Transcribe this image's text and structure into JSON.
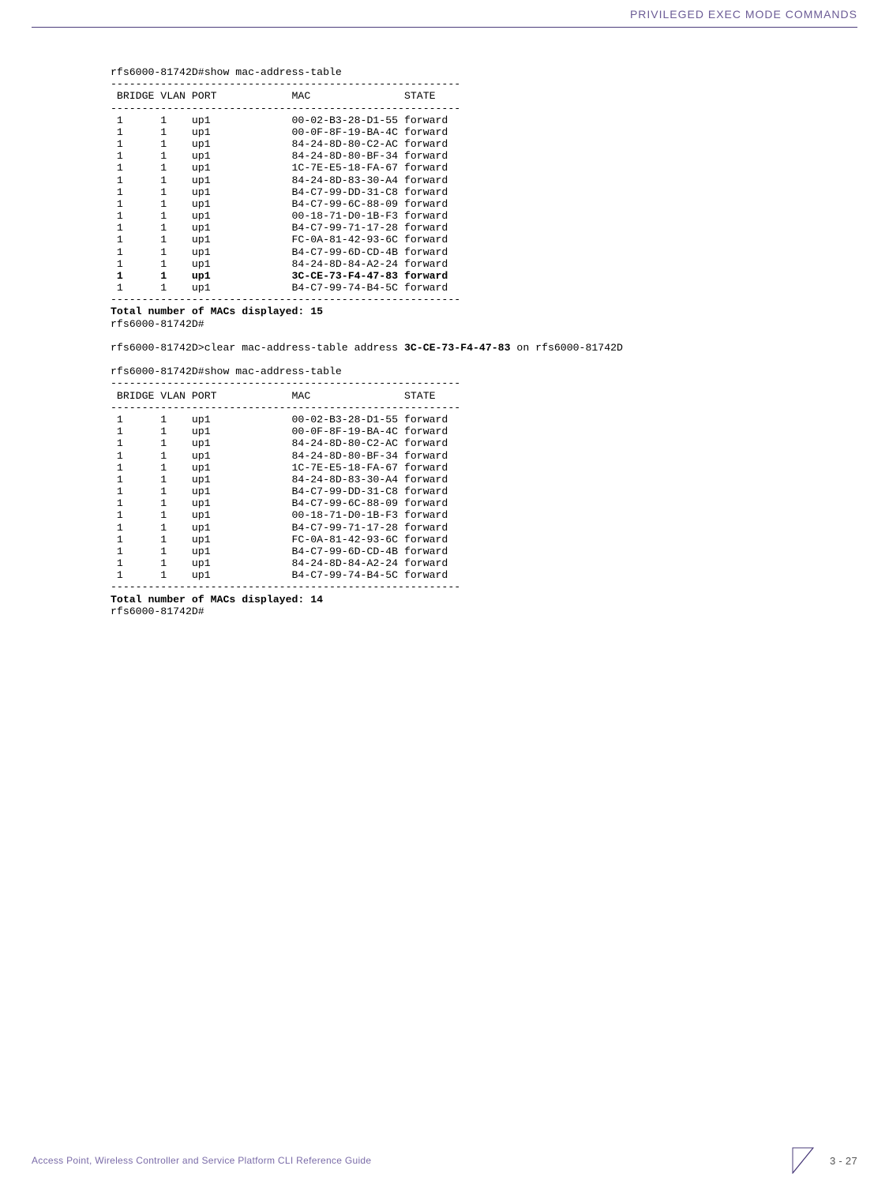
{
  "header": {
    "section_title": "PRIVILEGED EXEC MODE COMMANDS"
  },
  "terminal": {
    "cmd1": "rfs6000-81742D#show mac-address-table",
    "divider": "--------------------------------------------------------",
    "header_row": " BRIDGE VLAN PORT            MAC               STATE",
    "table1": [
      " 1      1    up1             00-02-B3-28-D1-55 forward",
      " 1      1    up1             00-0F-8F-19-BA-4C forward",
      " 1      1    up1             84-24-8D-80-C2-AC forward",
      " 1      1    up1             84-24-8D-80-BF-34 forward",
      " 1      1    up1             1C-7E-E5-18-FA-67 forward",
      " 1      1    up1             84-24-8D-83-30-A4 forward",
      " 1      1    up1             B4-C7-99-DD-31-C8 forward",
      " 1      1    up1             B4-C7-99-6C-88-09 forward",
      " 1      1    up1             00-18-71-D0-1B-F3 forward",
      " 1      1    up1             B4-C7-99-71-17-28 forward",
      " 1      1    up1             FC-0A-81-42-93-6C forward",
      " 1      1    up1             B4-C7-99-6D-CD-4B forward",
      " 1      1    up1             84-24-8D-84-A2-24 forward"
    ],
    "table1_bold_row": " 1      1    up1             3C-CE-73-F4-47-83 forward",
    "table1_last_row": " 1      1    up1             B4-C7-99-74-B4-5C forward",
    "summary1": "Total number of MACs displayed: 15",
    "prompt1": "rfs6000-81742D#",
    "blank": "",
    "cmd2_pre": "rfs6000-81742D>clear mac-address-table address ",
    "cmd2_bold": "3C-CE-73-F4-47-83",
    "cmd2_post": " on rfs6000-81742D",
    "cmd3": "rfs6000-81742D#show mac-address-table",
    "table2": [
      " 1      1    up1             00-02-B3-28-D1-55 forward",
      " 1      1    up1             00-0F-8F-19-BA-4C forward",
      " 1      1    up1             84-24-8D-80-C2-AC forward",
      " 1      1    up1             84-24-8D-80-BF-34 forward",
      " 1      1    up1             1C-7E-E5-18-FA-67 forward",
      " 1      1    up1             84-24-8D-83-30-A4 forward",
      " 1      1    up1             B4-C7-99-DD-31-C8 forward",
      " 1      1    up1             B4-C7-99-6C-88-09 forward",
      " 1      1    up1             00-18-71-D0-1B-F3 forward",
      " 1      1    up1             B4-C7-99-71-17-28 forward",
      " 1      1    up1             FC-0A-81-42-93-6C forward",
      " 1      1    up1             B4-C7-99-6D-CD-4B forward",
      " 1      1    up1             84-24-8D-84-A2-24 forward",
      " 1      1    up1             B4-C7-99-74-B4-5C forward"
    ],
    "summary2": "Total number of MACs displayed: 14",
    "prompt2": "rfs6000-81742D#"
  },
  "footer": {
    "title": "Access Point, Wireless Controller and Service Platform CLI Reference Guide",
    "page": "3 - 27"
  }
}
